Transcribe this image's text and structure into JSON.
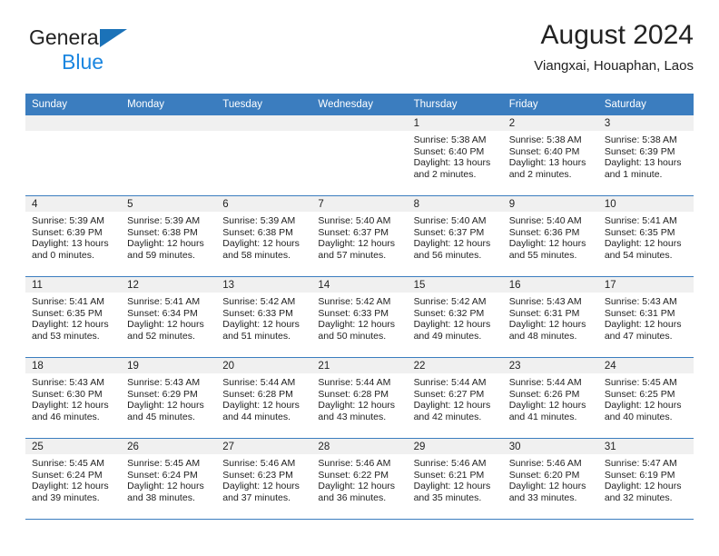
{
  "brand": {
    "line1": "General",
    "line2": "Blue",
    "triangle_color": "#1b72b8",
    "blue_text_color": "#1b86e0"
  },
  "header": {
    "title": "August 2024",
    "location": "Viangxai, Houaphan, Laos"
  },
  "theme": {
    "header_row_bg": "#3b7dbf",
    "daynum_bg": "#f0f0f0",
    "grid_line": "#3b7dbf",
    "text": "#222222"
  },
  "weekdays": [
    "Sunday",
    "Monday",
    "Tuesday",
    "Wednesday",
    "Thursday",
    "Friday",
    "Saturday"
  ],
  "weeks": [
    [
      {
        "day": "",
        "sunrise": "",
        "sunset": "",
        "daylight1": "",
        "daylight2": ""
      },
      {
        "day": "",
        "sunrise": "",
        "sunset": "",
        "daylight1": "",
        "daylight2": ""
      },
      {
        "day": "",
        "sunrise": "",
        "sunset": "",
        "daylight1": "",
        "daylight2": ""
      },
      {
        "day": "",
        "sunrise": "",
        "sunset": "",
        "daylight1": "",
        "daylight2": ""
      },
      {
        "day": "1",
        "sunrise": "Sunrise: 5:38 AM",
        "sunset": "Sunset: 6:40 PM",
        "daylight1": "Daylight: 13 hours",
        "daylight2": "and 2 minutes."
      },
      {
        "day": "2",
        "sunrise": "Sunrise: 5:38 AM",
        "sunset": "Sunset: 6:40 PM",
        "daylight1": "Daylight: 13 hours",
        "daylight2": "and 2 minutes."
      },
      {
        "day": "3",
        "sunrise": "Sunrise: 5:38 AM",
        "sunset": "Sunset: 6:39 PM",
        "daylight1": "Daylight: 13 hours",
        "daylight2": "and 1 minute."
      }
    ],
    [
      {
        "day": "4",
        "sunrise": "Sunrise: 5:39 AM",
        "sunset": "Sunset: 6:39 PM",
        "daylight1": "Daylight: 13 hours",
        "daylight2": "and 0 minutes."
      },
      {
        "day": "5",
        "sunrise": "Sunrise: 5:39 AM",
        "sunset": "Sunset: 6:38 PM",
        "daylight1": "Daylight: 12 hours",
        "daylight2": "and 59 minutes."
      },
      {
        "day": "6",
        "sunrise": "Sunrise: 5:39 AM",
        "sunset": "Sunset: 6:38 PM",
        "daylight1": "Daylight: 12 hours",
        "daylight2": "and 58 minutes."
      },
      {
        "day": "7",
        "sunrise": "Sunrise: 5:40 AM",
        "sunset": "Sunset: 6:37 PM",
        "daylight1": "Daylight: 12 hours",
        "daylight2": "and 57 minutes."
      },
      {
        "day": "8",
        "sunrise": "Sunrise: 5:40 AM",
        "sunset": "Sunset: 6:37 PM",
        "daylight1": "Daylight: 12 hours",
        "daylight2": "and 56 minutes."
      },
      {
        "day": "9",
        "sunrise": "Sunrise: 5:40 AM",
        "sunset": "Sunset: 6:36 PM",
        "daylight1": "Daylight: 12 hours",
        "daylight2": "and 55 minutes."
      },
      {
        "day": "10",
        "sunrise": "Sunrise: 5:41 AM",
        "sunset": "Sunset: 6:35 PM",
        "daylight1": "Daylight: 12 hours",
        "daylight2": "and 54 minutes."
      }
    ],
    [
      {
        "day": "11",
        "sunrise": "Sunrise: 5:41 AM",
        "sunset": "Sunset: 6:35 PM",
        "daylight1": "Daylight: 12 hours",
        "daylight2": "and 53 minutes."
      },
      {
        "day": "12",
        "sunrise": "Sunrise: 5:41 AM",
        "sunset": "Sunset: 6:34 PM",
        "daylight1": "Daylight: 12 hours",
        "daylight2": "and 52 minutes."
      },
      {
        "day": "13",
        "sunrise": "Sunrise: 5:42 AM",
        "sunset": "Sunset: 6:33 PM",
        "daylight1": "Daylight: 12 hours",
        "daylight2": "and 51 minutes."
      },
      {
        "day": "14",
        "sunrise": "Sunrise: 5:42 AM",
        "sunset": "Sunset: 6:33 PM",
        "daylight1": "Daylight: 12 hours",
        "daylight2": "and 50 minutes."
      },
      {
        "day": "15",
        "sunrise": "Sunrise: 5:42 AM",
        "sunset": "Sunset: 6:32 PM",
        "daylight1": "Daylight: 12 hours",
        "daylight2": "and 49 minutes."
      },
      {
        "day": "16",
        "sunrise": "Sunrise: 5:43 AM",
        "sunset": "Sunset: 6:31 PM",
        "daylight1": "Daylight: 12 hours",
        "daylight2": "and 48 minutes."
      },
      {
        "day": "17",
        "sunrise": "Sunrise: 5:43 AM",
        "sunset": "Sunset: 6:31 PM",
        "daylight1": "Daylight: 12 hours",
        "daylight2": "and 47 minutes."
      }
    ],
    [
      {
        "day": "18",
        "sunrise": "Sunrise: 5:43 AM",
        "sunset": "Sunset: 6:30 PM",
        "daylight1": "Daylight: 12 hours",
        "daylight2": "and 46 minutes."
      },
      {
        "day": "19",
        "sunrise": "Sunrise: 5:43 AM",
        "sunset": "Sunset: 6:29 PM",
        "daylight1": "Daylight: 12 hours",
        "daylight2": "and 45 minutes."
      },
      {
        "day": "20",
        "sunrise": "Sunrise: 5:44 AM",
        "sunset": "Sunset: 6:28 PM",
        "daylight1": "Daylight: 12 hours",
        "daylight2": "and 44 minutes."
      },
      {
        "day": "21",
        "sunrise": "Sunrise: 5:44 AM",
        "sunset": "Sunset: 6:28 PM",
        "daylight1": "Daylight: 12 hours",
        "daylight2": "and 43 minutes."
      },
      {
        "day": "22",
        "sunrise": "Sunrise: 5:44 AM",
        "sunset": "Sunset: 6:27 PM",
        "daylight1": "Daylight: 12 hours",
        "daylight2": "and 42 minutes."
      },
      {
        "day": "23",
        "sunrise": "Sunrise: 5:44 AM",
        "sunset": "Sunset: 6:26 PM",
        "daylight1": "Daylight: 12 hours",
        "daylight2": "and 41 minutes."
      },
      {
        "day": "24",
        "sunrise": "Sunrise: 5:45 AM",
        "sunset": "Sunset: 6:25 PM",
        "daylight1": "Daylight: 12 hours",
        "daylight2": "and 40 minutes."
      }
    ],
    [
      {
        "day": "25",
        "sunrise": "Sunrise: 5:45 AM",
        "sunset": "Sunset: 6:24 PM",
        "daylight1": "Daylight: 12 hours",
        "daylight2": "and 39 minutes."
      },
      {
        "day": "26",
        "sunrise": "Sunrise: 5:45 AM",
        "sunset": "Sunset: 6:24 PM",
        "daylight1": "Daylight: 12 hours",
        "daylight2": "and 38 minutes."
      },
      {
        "day": "27",
        "sunrise": "Sunrise: 5:46 AM",
        "sunset": "Sunset: 6:23 PM",
        "daylight1": "Daylight: 12 hours",
        "daylight2": "and 37 minutes."
      },
      {
        "day": "28",
        "sunrise": "Sunrise: 5:46 AM",
        "sunset": "Sunset: 6:22 PM",
        "daylight1": "Daylight: 12 hours",
        "daylight2": "and 36 minutes."
      },
      {
        "day": "29",
        "sunrise": "Sunrise: 5:46 AM",
        "sunset": "Sunset: 6:21 PM",
        "daylight1": "Daylight: 12 hours",
        "daylight2": "and 35 minutes."
      },
      {
        "day": "30",
        "sunrise": "Sunrise: 5:46 AM",
        "sunset": "Sunset: 6:20 PM",
        "daylight1": "Daylight: 12 hours",
        "daylight2": "and 33 minutes."
      },
      {
        "day": "31",
        "sunrise": "Sunrise: 5:47 AM",
        "sunset": "Sunset: 6:19 PM",
        "daylight1": "Daylight: 12 hours",
        "daylight2": "and 32 minutes."
      }
    ]
  ]
}
